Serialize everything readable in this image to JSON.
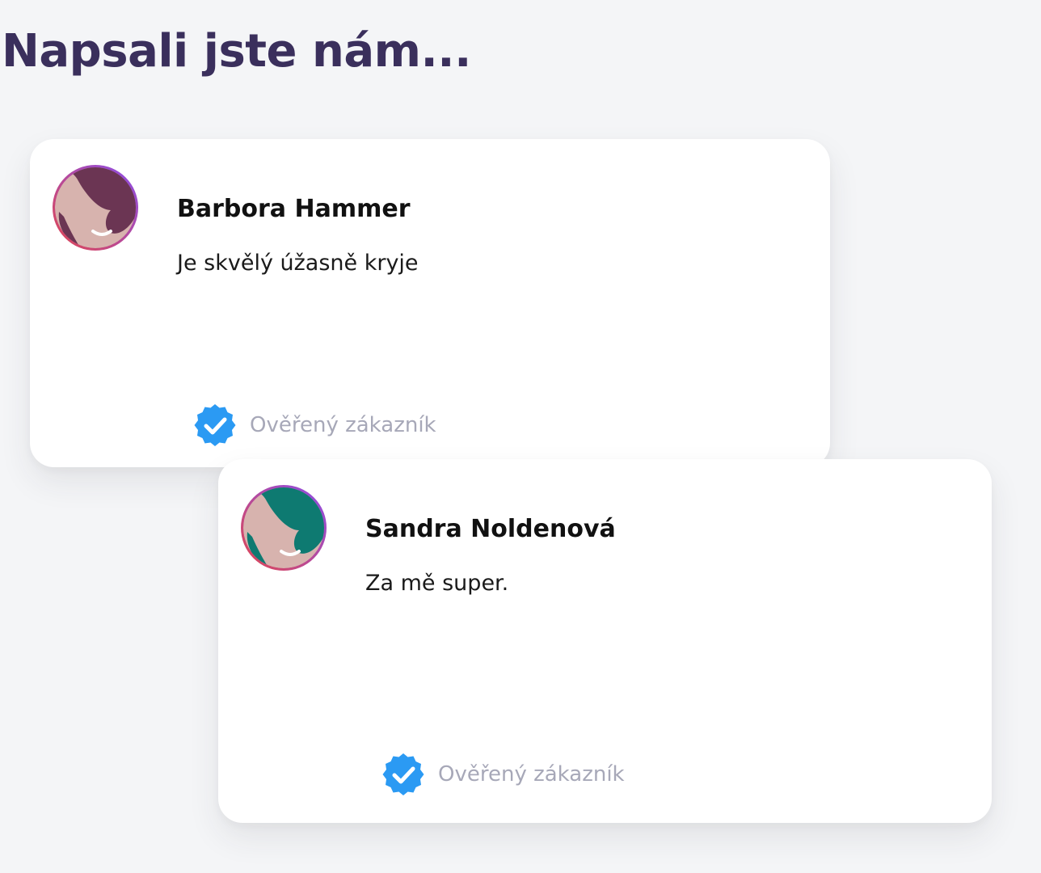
{
  "page": {
    "title": "Napsali jste nám..."
  },
  "colors": {
    "title": "#3a2f5c",
    "background": "#f4f5f7",
    "verified_badge": "#2b9af3",
    "verified_text": "#a7a8b8",
    "avatar_ring_start": "#e1464f",
    "avatar_ring_end": "#8a4dea",
    "avatar_face": "#d7b3ae"
  },
  "reviews": [
    {
      "name": "Barbora Hammer",
      "text": "Je skvělý úžasně kryje",
      "verified_label": "Ověřený zákazník",
      "avatar_icon": "woman-avatar-icon",
      "avatar_hair_color": "#6b3553"
    },
    {
      "name": "Sandra Noldenová",
      "text": "Za mě super.",
      "verified_label": "Ověřený zákazník",
      "avatar_icon": "woman-avatar-icon",
      "avatar_hair_color": "#0e7a71"
    }
  ]
}
